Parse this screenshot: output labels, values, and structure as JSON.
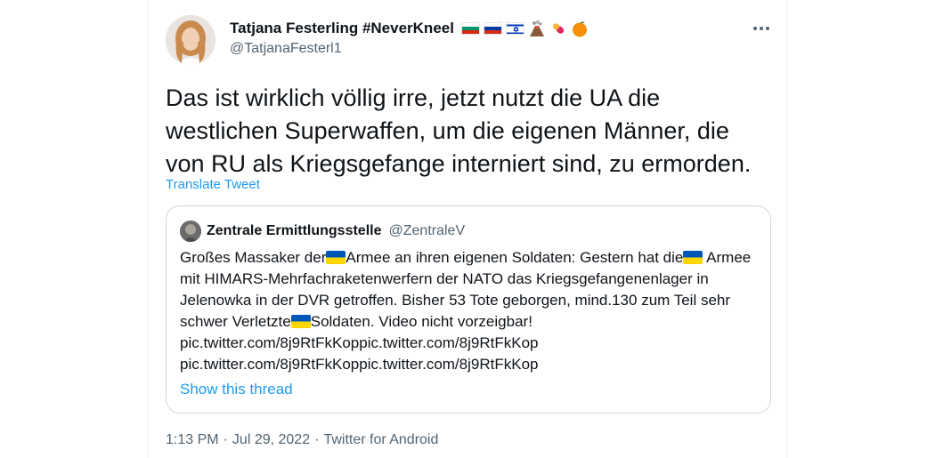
{
  "tweet": {
    "display_name": "Tatjana Festerling #NeverKneel",
    "handle": "@TatjanaFesterl1",
    "flags": [
      "bulgaria-flag",
      "russia-flag",
      "israel-flag",
      "volcano-emoji",
      "pill-emoji",
      "orange-emoji"
    ],
    "text": "Das ist wirklich völlig irre, jetzt nutzt die UA die westlichen Superwaffen, um die eigenen Männer, die von RU als Kriegsgefange interniert sind, zu ermorden.",
    "translate_label": "Translate Tweet",
    "more_icon": "more-dots-icon"
  },
  "quote": {
    "display_name": "Zentrale Ermittlungsstelle",
    "handle": "@ZentraleV",
    "text_parts": [
      "Großes Massaker der",
      "Armee an ihren eigenen Soldaten: Gestern hat die",
      "Armee mit HIMARS-Mehrfachraketenwerfern der NATO das Kriegsgefangenenlager in Jelenowka in der DVR getroffen. Bisher 53 Tote geborgen, mind.130 zum Teil sehr schwer Verletzte",
      "Soldaten. Video nicht vorzeigbar! pic.twitter.com/8j9RtFkKoppic.twitter.com/8j9RtFkKop pic.twitter.com/8j9RtFkKoppic.twitter.com/8j9RtFkKop"
    ],
    "show_thread_label": "Show this thread"
  },
  "meta": {
    "time": "1:13 PM",
    "date": "Jul 29, 2022",
    "source": "Twitter for Android",
    "separator": "·"
  },
  "colors": {
    "accent": "#1d9bf0",
    "secondary_text": "#536471",
    "border": "#cfd9de"
  }
}
